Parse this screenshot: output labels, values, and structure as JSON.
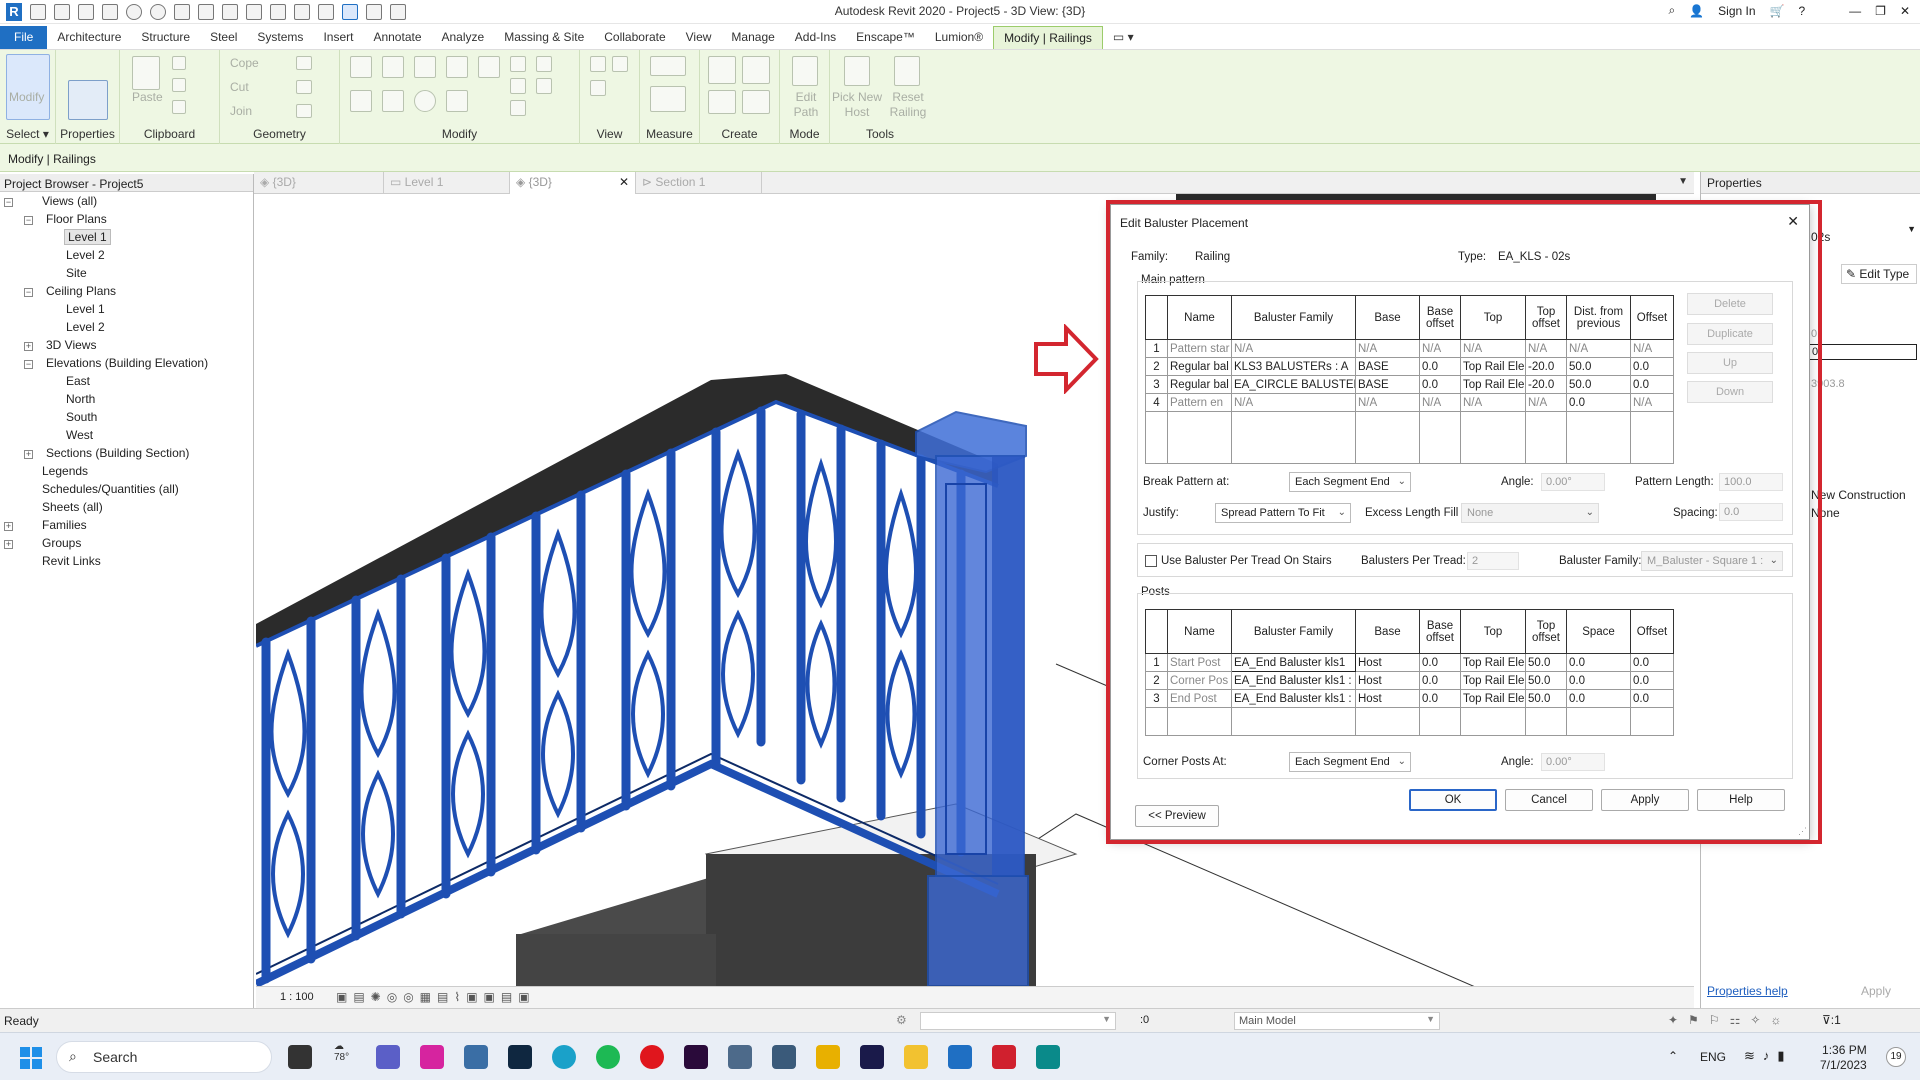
{
  "app": {
    "title": "Autodesk Revit 2020 - Project5 - 3D View: {3D}",
    "sign_in": "Sign In"
  },
  "menu": [
    "File",
    "Architecture",
    "Structure",
    "Steel",
    "Systems",
    "Insert",
    "Annotate",
    "Analyze",
    "Massing & Site",
    "Collaborate",
    "View",
    "Manage",
    "Add-Ins",
    "Enscape™",
    "Lumion®",
    "Modify | Railings"
  ],
  "ribbon": {
    "panels": [
      "Select",
      "Properties",
      "Clipboard",
      "Geometry",
      "Modify",
      "View",
      "Measure",
      "Create",
      "Mode",
      "Tools"
    ],
    "items": {
      "modify": "Modify",
      "paste": "Paste",
      "cope": "Cope",
      "cut": "Cut",
      "join": "Join",
      "edit_path": "Edit Path",
      "pick_new_host": "Pick New Host",
      "reset_railing": "Reset Railing"
    }
  },
  "context_bar": "Modify | Railings",
  "browser": {
    "title": "Project Browser - Project5",
    "items": [
      "Views (all)",
      "Floor Plans",
      "Level 1",
      "Level 2",
      "Site",
      "Ceiling Plans",
      "Level 1",
      "Level 2",
      "3D Views",
      "Elevations (Building Elevation)",
      "East",
      "North",
      "South",
      "West",
      "Sections (Building Section)",
      "Legends",
      "Schedules/Quantities (all)",
      "Sheets (all)",
      "Families",
      "Groups",
      "Revit Links"
    ]
  },
  "view_tabs": [
    "{3D}",
    "Level 1",
    "{3D}",
    "Section 1"
  ],
  "properties": {
    "title": "Properties",
    "type_frag": "02s",
    "edit_type": "Edit Type",
    "val1": "0.",
    "val2": "0.",
    "val3": "3903.8",
    "phase_created": "New Construction",
    "phase_demo": "None",
    "help": "Properties help",
    "apply": "Apply"
  },
  "dialog": {
    "title": "Edit Baluster Placement",
    "family_label": "Family:",
    "family_value": "Railing",
    "type_label": "Type:",
    "type_value": "EA_KLS - 02s",
    "main_pattern_label": "Main pattern",
    "main_headers": [
      "Name",
      "Baluster Family",
      "Base",
      "Base offset",
      "Top",
      "Top offset",
      "Dist. from previous",
      "Offset"
    ],
    "main_rows": [
      [
        "1",
        "Pattern star",
        "N/A",
        "N/A",
        "N/A",
        "N/A",
        "N/A",
        "N/A",
        "N/A"
      ],
      [
        "2",
        "Regular bal",
        "KLS3 BALUSTERs : A",
        "BASE",
        "0.0",
        "Top Rail Ele",
        "-20.0",
        "50.0",
        "0.0"
      ],
      [
        "3",
        "Regular bal",
        "EA_CIRCLE BALUSTER :",
        "BASE",
        "0.0",
        "Top Rail Ele",
        "-20.0",
        "50.0",
        "0.0"
      ],
      [
        "4",
        "Pattern en",
        "N/A",
        "N/A",
        "N/A",
        "N/A",
        "N/A",
        "0.0",
        "N/A"
      ]
    ],
    "side_buttons": [
      "Delete",
      "Duplicate",
      "Up",
      "Down"
    ],
    "break_label": "Break Pattern at:",
    "break_value": "Each Segment End",
    "angle_label": "Angle:",
    "angle_value": "0.00°",
    "pattern_length_label": "Pattern Length:",
    "pattern_length_value": "100.0",
    "justify_label": "Justify:",
    "justify_value": "Spread Pattern To Fit",
    "excess_label": "Excess Length Fill :",
    "excess_value": "None",
    "spacing_label": "Spacing:",
    "spacing_value": "0.0",
    "per_tread_label": "Use Baluster Per Tread On Stairs",
    "per_tread_checked": false,
    "balusters_per_tread_label": "Balusters Per Tread:",
    "balusters_per_tread_value": "2",
    "baluster_family_label": "Baluster Family:",
    "baluster_family_value": "M_Baluster - Square 1 :",
    "posts_label": "Posts",
    "post_headers": [
      "Name",
      "Baluster Family",
      "Base",
      "Base offset",
      "Top",
      "Top offset",
      "Space",
      "Offset"
    ],
    "post_rows": [
      [
        "1",
        "Start Post",
        "EA_End Baluster kls1",
        "Host",
        "0.0",
        "Top Rail Ele",
        "50.0",
        "0.0",
        "0.0"
      ],
      [
        "2",
        "Corner Pos",
        "EA_End Baluster kls1 :",
        "Host",
        "0.0",
        "Top Rail Ele",
        "50.0",
        "0.0",
        "0.0"
      ],
      [
        "3",
        "End Post",
        "EA_End Baluster kls1 :",
        "Host",
        "0.0",
        "Top Rail Ele",
        "50.0",
        "0.0",
        "0.0"
      ]
    ],
    "corner_label": "Corner Posts At:",
    "corner_value": "Each Segment End",
    "corner_angle_label": "Angle:",
    "corner_angle_value": "0.00°",
    "preview": "<< Preview",
    "ok": "OK",
    "cancel": "Cancel",
    "apply": "Apply",
    "help": "Help"
  },
  "view_control": {
    "scale": "1 : 100"
  },
  "status": {
    "text": "Ready",
    "worksets": ":0",
    "model": "Main Model",
    "filter": ":1"
  },
  "taskbar": {
    "search": "Search",
    "weather": "78°",
    "lang": "ENG",
    "time": "1:36 PM",
    "date": "7/1/2023",
    "badge": "19"
  },
  "colors": {
    "accent": "#1f6fc3",
    "ribbon": "#eef7e3",
    "highlight": "#d3262f",
    "railing": "#1e4fb3"
  }
}
